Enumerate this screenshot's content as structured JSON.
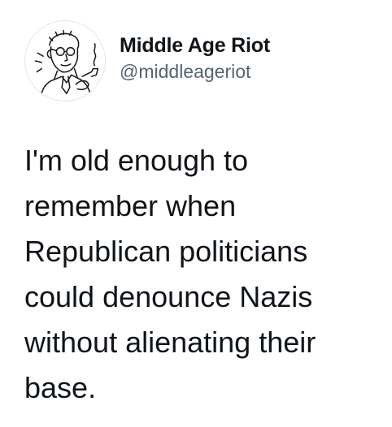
{
  "tweet": {
    "avatar_icon": "man-with-pipe-illustration",
    "display_name": "Middle Age Riot",
    "handle": "@middleageriot",
    "text": "I'm old enough to\nremember when\nRepublican politicians\ncould denounce Nazis\nwithout alienating their\nbase."
  }
}
